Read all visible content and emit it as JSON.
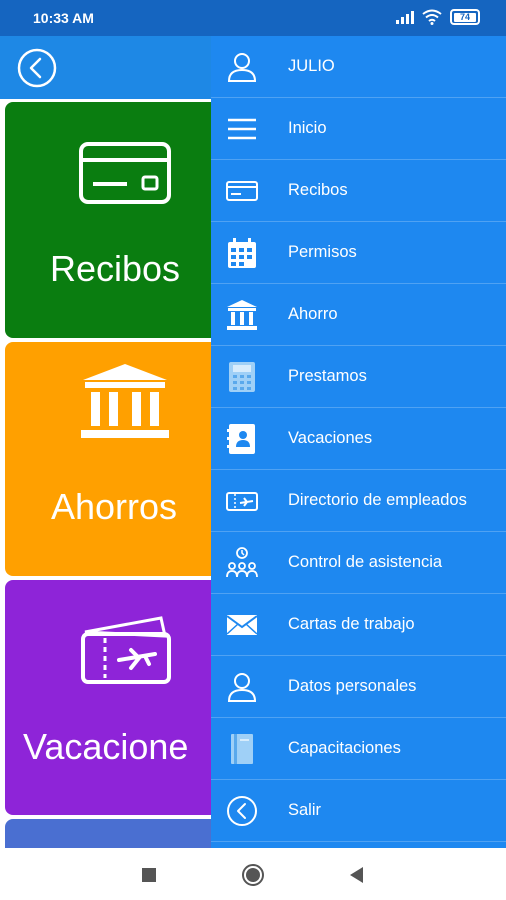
{
  "status_bar": {
    "time": "10:33 AM",
    "battery": "74",
    "icons": [
      "signal-icon",
      "wifi-icon",
      "battery-icon"
    ]
  },
  "header": {
    "back_icon": "back-circle-icon"
  },
  "tiles": [
    {
      "label": "Recibos",
      "icon": "credit-card-icon",
      "color": "#0a7d10"
    },
    {
      "label": "Ahorros",
      "icon": "bank-icon",
      "color": "#ffa000"
    },
    {
      "label": "Vacacione",
      "icon": "ticket-plane-icon",
      "color": "#8e24d8"
    },
    {
      "label": "",
      "icon": "",
      "color": "#4a6fd1"
    }
  ],
  "drawer": {
    "color": "#1e88f0",
    "items": [
      {
        "label": "JULIO",
        "icon": "user-icon"
      },
      {
        "label": "Inicio",
        "icon": "menu-icon"
      },
      {
        "label": "Recibos",
        "icon": "credit-card-icon"
      },
      {
        "label": "Permisos",
        "icon": "calendar-icon"
      },
      {
        "label": "Ahorro",
        "icon": "bank-icon"
      },
      {
        "label": "Prestamos",
        "icon": "calculator-icon"
      },
      {
        "label": "Vacaciones",
        "icon": "contacts-book-icon"
      },
      {
        "label": "Directorio de empleados",
        "icon": "ticket-plane-icon"
      },
      {
        "label": "Control de asistencia",
        "icon": "team-clock-icon"
      },
      {
        "label": "Cartas de trabajo",
        "icon": "envelope-icon"
      },
      {
        "label": "Datos personales",
        "icon": "user-icon"
      },
      {
        "label": "Capacitaciones",
        "icon": "book-icon"
      },
      {
        "label": "Salir",
        "icon": "back-circle-icon"
      }
    ]
  },
  "nav_bar": {
    "buttons": [
      "recent-apps-icon",
      "home-icon",
      "back-icon"
    ]
  }
}
